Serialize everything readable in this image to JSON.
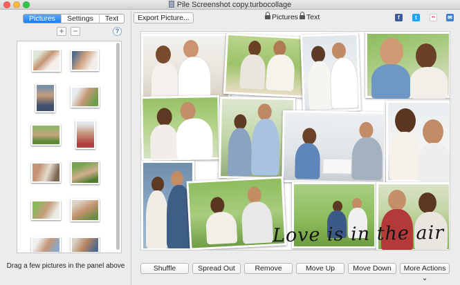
{
  "window": {
    "title": "Pile Screenshot copy.turbocollage"
  },
  "left_panel": {
    "tabs": [
      {
        "label": "Pictures",
        "active": true
      },
      {
        "label": "Settings",
        "active": false
      },
      {
        "label": "Text",
        "active": false
      }
    ],
    "add_label": "+",
    "remove_label": "−",
    "help_label": "?",
    "hint": "Drag a few pictures in the panel above"
  },
  "toolbar": {
    "export_label": "Export Picture...",
    "mode_pictures": "Pictures",
    "mode_text": "Text",
    "social": [
      {
        "name": "facebook-icon",
        "glyph": "f",
        "color": "#3b5998"
      },
      {
        "name": "twitter-icon",
        "glyph": "t",
        "color": "#1da1f2"
      },
      {
        "name": "flickr-icon",
        "glyph": "••",
        "color": "#ffffff"
      },
      {
        "name": "email-icon",
        "glyph": "✉",
        "color": "#3a7fd5"
      }
    ]
  },
  "collage": {
    "caption": "Love is in the air"
  },
  "actions": {
    "shuffle": "Shuffle",
    "spread_out": "Spread Out",
    "remove": "Remove",
    "move_up": "Move Up",
    "move_down": "Move Down",
    "more_actions": "More Actions",
    "more_chevron": "⌄"
  },
  "colors": {
    "accent": "#1a7ff0",
    "couple_warm": "#c89a74",
    "sky": "#9cc4e4",
    "grass": "#7fb04a"
  }
}
